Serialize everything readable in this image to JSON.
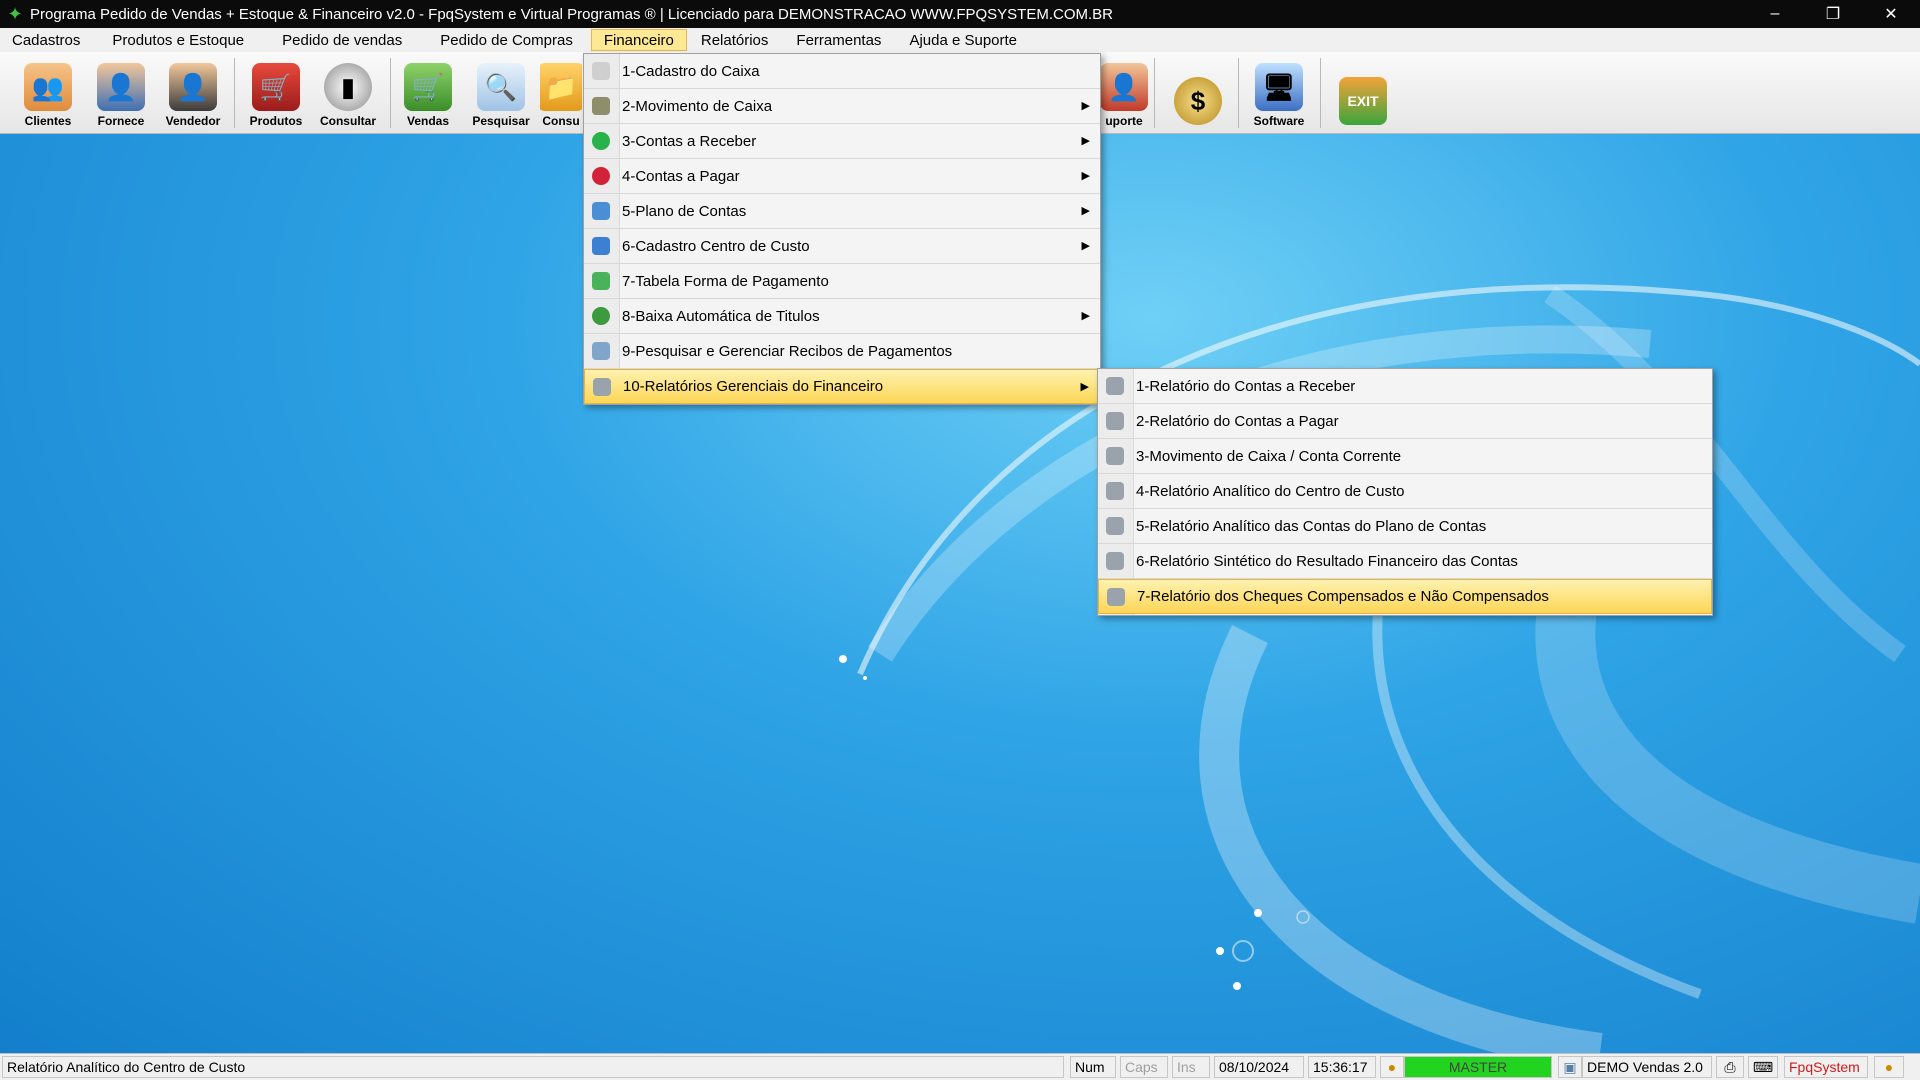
{
  "window": {
    "title": "Programa Pedido de Vendas + Estoque & Financeiro v2.0 - FpqSystem e Virtual Programas ® | Licenciado para  DEMONSTRACAO WWW.FPQSYSTEM.COM.BR",
    "minimize_glyph": "–",
    "restore_glyph": "❐",
    "close_glyph": "✕"
  },
  "menubar": {
    "items": [
      {
        "label": "Cadastros"
      },
      {
        "label": "Produtos e Estoque"
      },
      {
        "label": "Pedido de vendas"
      },
      {
        "label": "Pedido de Compras"
      },
      {
        "label": "Financeiro"
      },
      {
        "label": "Relatórios"
      },
      {
        "label": "Ferramentas"
      },
      {
        "label": "Ajuda e Suporte"
      }
    ],
    "active": "Financeiro"
  },
  "toolbar": {
    "items": [
      {
        "label": "Clientes",
        "icon": "clients-icon"
      },
      {
        "label": "Fornece",
        "icon": "supplier-icon"
      },
      {
        "label": "Vendedor",
        "icon": "seller-icon"
      },
      {
        "label": "Produtos",
        "icon": "products-icon"
      },
      {
        "label": "Consultar",
        "icon": "barcode-icon"
      },
      {
        "label": "Vendas",
        "icon": "cart-icon"
      },
      {
        "label": "Pesquisar",
        "icon": "search-icon"
      },
      {
        "label": "Consu",
        "icon": "folder-icon"
      },
      {
        "label": "uporte",
        "icon": "support-icon"
      },
      {
        "label": "",
        "icon": "coin-icon"
      },
      {
        "label": "Software",
        "icon": "monitor-icon"
      },
      {
        "label": "",
        "icon": "exit-icon"
      }
    ]
  },
  "financeiro_menu": {
    "items": [
      {
        "label": "1-Cadastro do Caixa",
        "submenu": false,
        "color": "#cfcfcf"
      },
      {
        "label": "2-Movimento de Caixa",
        "submenu": true,
        "color": "#8e8e6a"
      },
      {
        "label": "3-Contas a Receber",
        "submenu": true,
        "color": "#29b14a"
      },
      {
        "label": "4-Contas a Pagar",
        "submenu": true,
        "color": "#d2223a"
      },
      {
        "label": "5-Plano de Contas",
        "submenu": true,
        "color": "#4a8fd6"
      },
      {
        "label": "6-Cadastro Centro de Custo",
        "submenu": true,
        "color": "#3d7fd0"
      },
      {
        "label": "7-Tabela Forma de Pagamento",
        "submenu": false,
        "color": "#48b35a"
      },
      {
        "label": "8-Baixa Automática de Titulos",
        "submenu": true,
        "color": "#3d9a3d"
      },
      {
        "label": "9-Pesquisar e Gerenciar Recibos de Pagamentos",
        "submenu": false,
        "color": "#7fa6c9"
      },
      {
        "label": "10-Relatórios Gerenciais do Financeiro",
        "submenu": true,
        "color": "#9aa3ab"
      }
    ],
    "highlighted": "10-Relatórios Gerenciais do Financeiro"
  },
  "relatorios_submenu": {
    "items": [
      {
        "label": "1-Relatório do Contas a Receber"
      },
      {
        "label": "2-Relatório do Contas a Pagar"
      },
      {
        "label": "3-Movimento de Caixa / Conta Corrente"
      },
      {
        "label": "4-Relatório Analítico do Centro de Custo"
      },
      {
        "label": "5-Relatório Analítico das Contas do Plano de Contas"
      },
      {
        "label": "6-Relatório Sintético do Resultado Financeiro das Contas"
      },
      {
        "label": "7-Relatório dos Cheques Compensados e Não Compensados"
      }
    ],
    "highlighted": "7-Relatório dos Cheques Compensados e Não Compensados",
    "icon": "printer-icon"
  },
  "statusbar": {
    "hint": "Relatório Analítico do Centro de Custo",
    "num": "Num",
    "caps": "Caps",
    "ins": "Ins",
    "date": "08/10/2024",
    "time": "15:36:17",
    "user": "MASTER",
    "version": "DEMO Vendas 2.0",
    "brand": "FpqSystem"
  },
  "colors": {
    "titlebar": "#0b0b0b",
    "menu_active": "#fde894",
    "highlight": "#fbd656",
    "desktop": "#1a8fd6",
    "master_badge": "#22d41f",
    "brand_red": "#d21a1a"
  }
}
